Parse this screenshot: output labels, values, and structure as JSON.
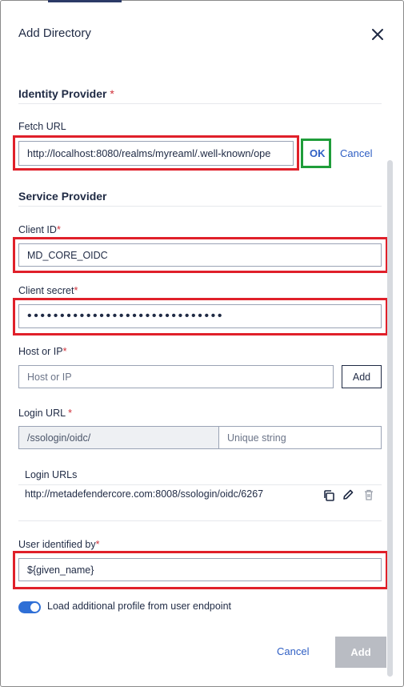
{
  "dialog": {
    "title": "Add Directory"
  },
  "identity_provider": {
    "heading": "Identity Provider",
    "required_mark": "*",
    "fetch_url_label": "Fetch URL",
    "fetch_url_value": "http://localhost:8080/realms/myreaml/.well-known/ope",
    "ok_label": "OK",
    "cancel_label": "Cancel"
  },
  "service_provider": {
    "heading": "Service Provider",
    "client_id_label": "Client ID",
    "client_id_value": "MD_CORE_OIDC",
    "client_secret_label": "Client secret",
    "client_secret_value": "••••••••••••••••••••••••••••••",
    "host_label": "Host or IP",
    "host_placeholder": "Host or IP",
    "host_add_label": "Add",
    "login_url_label": "Login URL",
    "login_url_prefix": "/ssologin/oidc/",
    "login_url_placeholder": "Unique string",
    "login_urls_heading": "Login URLs",
    "login_urls": [
      "http://metadefendercore.com:8008/ssologin/oidc/6267"
    ],
    "user_identified_label": "User identified by",
    "user_identified_value": "${given_name}",
    "load_profile_label": "Load additional profile from user endpoint",
    "load_profile_enabled": true,
    "required_mark": "*"
  },
  "footer": {
    "cancel_label": "Cancel",
    "add_label": "Add"
  },
  "colors": {
    "highlight_red": "#e0202a",
    "highlight_green": "#1f9d3a",
    "link": "#2f5fc4",
    "toggle": "#2f6fd6"
  }
}
